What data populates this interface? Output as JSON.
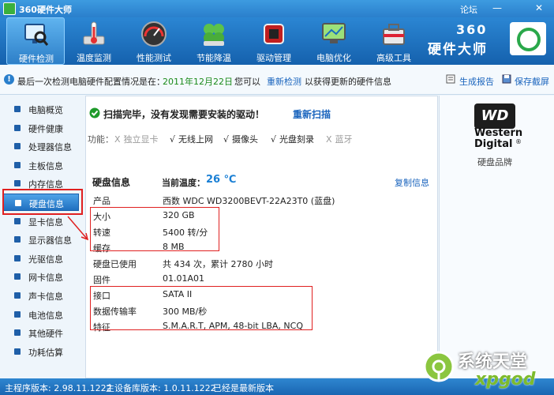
{
  "window": {
    "title": "360硬件大师",
    "forum_label": "论坛",
    "minimize_glyph": "—",
    "close_glyph": "✕"
  },
  "toolbar": {
    "items": [
      {
        "label": "硬件检测",
        "icon": "monitor-magnifier-icon"
      },
      {
        "label": "温度监测",
        "icon": "thermometer-icon"
      },
      {
        "label": "性能测试",
        "icon": "speedometer-icon"
      },
      {
        "label": "节能降温",
        "icon": "clover-icon"
      },
      {
        "label": "驱动管理",
        "icon": "driver-chip-icon"
      },
      {
        "label": "电脑优化",
        "icon": "screen-optimize-icon"
      },
      {
        "label": "高级工具",
        "icon": "toolbox-icon"
      }
    ],
    "active_index": 0
  },
  "brand": {
    "line1": "360",
    "line2": "硬件大师",
    "icon": "360-logo-icon"
  },
  "infobar": {
    "prefix": "最后一次检测电脑硬件配置情况是在：",
    "date": "2011年12月22日",
    "middle": "您可以",
    "recheck_link": "重新检测",
    "suffix": "以获得更新的硬件信息",
    "report_label": "生成报告",
    "screenshot_label": "保存截屏"
  },
  "sidebar": {
    "items": [
      "电脑概览",
      "硬件健康",
      "处理器信息",
      "主板信息",
      "内存信息",
      "硬盘信息",
      "显卡信息",
      "显示器信息",
      "光驱信息",
      "网卡信息",
      "声卡信息",
      "电池信息",
      "其他硬件",
      "功耗估算"
    ],
    "active_index": 5
  },
  "scan": {
    "message": "扫描完毕，没有发现需要安装的驱动！",
    "rescan_link": "重新扫描",
    "features_label": "功能：",
    "features": [
      {
        "mark": "X",
        "name": "独立显卡",
        "ok": false
      },
      {
        "mark": "√",
        "name": "无线上网",
        "ok": true
      },
      {
        "mark": "√",
        "name": "摄像头",
        "ok": true
      },
      {
        "mark": "√",
        "name": "光盘刻录",
        "ok": true
      },
      {
        "mark": "X",
        "name": "蓝牙",
        "ok": false
      }
    ]
  },
  "disk": {
    "section_title": "硬盘信息",
    "temp_label": "当前温度：",
    "temp_value": "26 ℃",
    "copy_link": "复制信息",
    "rows": [
      {
        "label": "产品",
        "value": "西数 WDC WD3200BEVT-22A23T0 (蓝盘)"
      },
      {
        "label": "大小",
        "value": "320 GB"
      },
      {
        "label": "转速",
        "value": "5400 转/分"
      },
      {
        "label": "缓存",
        "value": "8 MB"
      },
      {
        "label": "硬盘已使用",
        "value": "共 434 次，累计 2780 小时"
      },
      {
        "label": "固件",
        "value": "01.01A01"
      },
      {
        "label": "接口",
        "value": "SATA II"
      },
      {
        "label": "数据传输率",
        "value": "300 MB/秒"
      },
      {
        "label": "特征",
        "value": "S.M.A.R.T,  APM,  48-bit LBA,  NCQ"
      }
    ]
  },
  "brand_panel": {
    "logo_text": "WD",
    "logo_line1": "Western",
    "logo_line2": "Digital",
    "logo_mark": "®",
    "caption": "硬盘品牌"
  },
  "statusbar": {
    "main_version": "主程序版本: 2.98.11.1222",
    "db_version": "主设备库版本: 1.0.11.1222",
    "latest": "已经是最新版本"
  },
  "watermark": {
    "text": "系统天堂",
    "sub": "xpgod"
  },
  "colors": {
    "accent": "#1f74c4",
    "highlight_red": "#e02020",
    "ok_green": "#1a8a1a",
    "temp_blue": "#1a7fd4"
  }
}
